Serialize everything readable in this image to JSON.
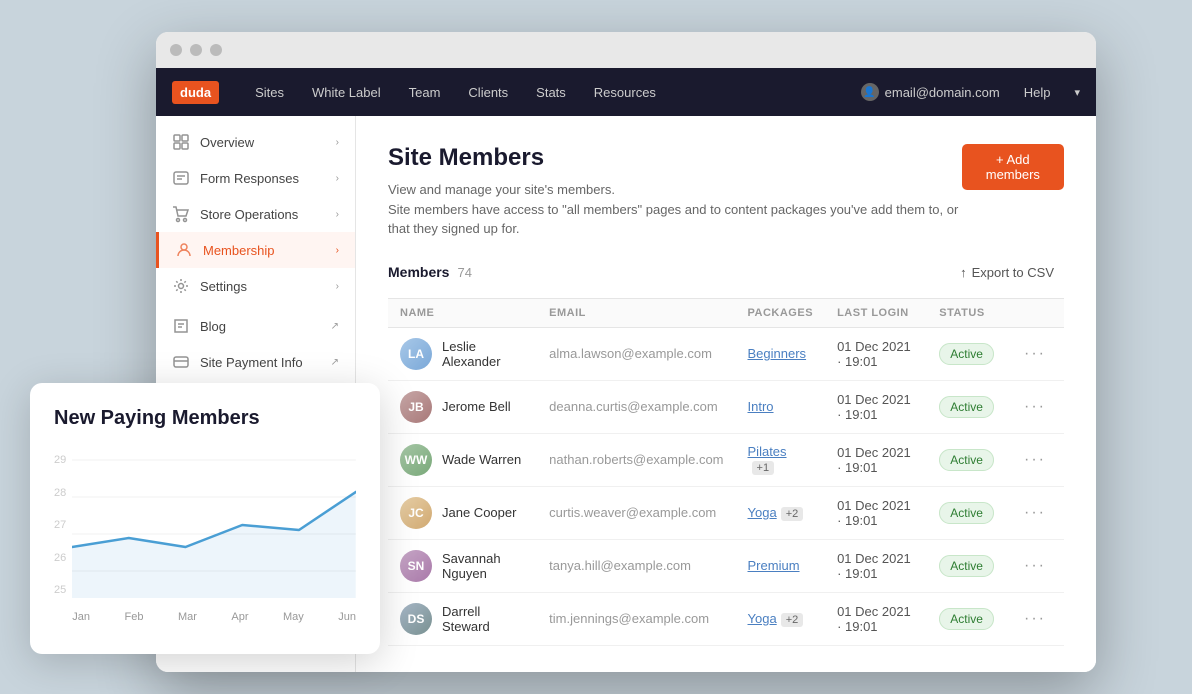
{
  "browser": {
    "dots": [
      "dot1",
      "dot2",
      "dot3"
    ]
  },
  "navbar": {
    "logo": "duda",
    "links": [
      "Sites",
      "White Label",
      "Team",
      "Clients",
      "Stats",
      "Resources"
    ],
    "help": "Help",
    "user_email": "email@domain.com"
  },
  "sidebar": {
    "items": [
      {
        "id": "overview",
        "label": "Overview",
        "has_chevron": true
      },
      {
        "id": "form-responses",
        "label": "Form Responses",
        "has_chevron": true
      },
      {
        "id": "store-operations",
        "label": "Store Operations",
        "has_chevron": true
      },
      {
        "id": "membership",
        "label": "Membership",
        "has_chevron": true,
        "active": true
      },
      {
        "id": "settings",
        "label": "Settings",
        "has_chevron": true
      },
      {
        "id": "blog",
        "label": "Blog",
        "has_ext": true
      },
      {
        "id": "site-payment-info",
        "label": "Site Payment Info",
        "has_ext": true
      }
    ]
  },
  "main": {
    "title": "Site Members",
    "description_line1": "View and manage your site's members.",
    "description_line2": "Site members have access to \"all members\" pages and to content packages you've add them to, or that they signed up for.",
    "add_members_label": "+ Add members",
    "members_label": "Members",
    "members_count": "74",
    "export_label": "Export to CSV",
    "table": {
      "columns": [
        "NAME",
        "EMAIL",
        "PACKAGES",
        "LAST LOGIN",
        "STATUS"
      ],
      "rows": [
        {
          "id": 1,
          "name": "Leslie Alexander",
          "email": "alma.lawson@example.com",
          "package": "Beginners",
          "package_extra": null,
          "last_login": "01 Dec 2021 · 19:01",
          "status": "Active",
          "avatar_class": "avatar-1",
          "initials": "LA"
        },
        {
          "id": 2,
          "name": "Jerome Bell",
          "email": "deanna.curtis@example.com",
          "package": "Intro",
          "package_extra": null,
          "last_login": "01 Dec 2021 · 19:01",
          "status": "Active",
          "avatar_class": "avatar-2",
          "initials": "JB"
        },
        {
          "id": 3,
          "name": "Wade Warren",
          "email": "nathan.roberts@example.com",
          "package": "Pilates",
          "package_extra": "+1",
          "last_login": "01 Dec 2021 · 19:01",
          "status": "Active",
          "avatar_class": "avatar-3",
          "initials": "WW"
        },
        {
          "id": 4,
          "name": "Jane Cooper",
          "email": "curtis.weaver@example.com",
          "package": "Yoga",
          "package_extra": "+2",
          "last_login": "01 Dec 2021 · 19:01",
          "status": "Active",
          "avatar_class": "avatar-4",
          "initials": "JC"
        },
        {
          "id": 5,
          "name": "Savannah Nguyen",
          "email": "tanya.hill@example.com",
          "package": "Premium",
          "package_extra": null,
          "last_login": "01 Dec 2021 · 19:01",
          "status": "Active",
          "avatar_class": "avatar-5",
          "initials": "SN"
        },
        {
          "id": 6,
          "name": "Darrell Steward",
          "email": "tim.jennings@example.com",
          "package": "Yoga",
          "package_extra": "+2",
          "last_login": "01 Dec 2021 · 19:01",
          "status": "Active",
          "avatar_class": "avatar-6",
          "initials": "DS"
        }
      ]
    }
  },
  "chart": {
    "title": "New Paying Members",
    "y_labels": [
      "29",
      "28",
      "27",
      "26",
      "25"
    ],
    "x_labels": [
      "Jan",
      "Feb",
      "Mar",
      "Apr",
      "May",
      "Jun"
    ],
    "data_points": [
      {
        "x": 0,
        "y": 26.3,
        "label": "Jan"
      },
      {
        "x": 1,
        "y": 26.8,
        "label": "Feb"
      },
      {
        "x": 2,
        "y": 26.3,
        "label": "Mar"
      },
      {
        "x": 3,
        "y": 27.5,
        "label": "Apr"
      },
      {
        "x": 4,
        "y": 27.2,
        "label": "May"
      },
      {
        "x": 5,
        "y": 28.5,
        "label": "Jun"
      }
    ]
  }
}
